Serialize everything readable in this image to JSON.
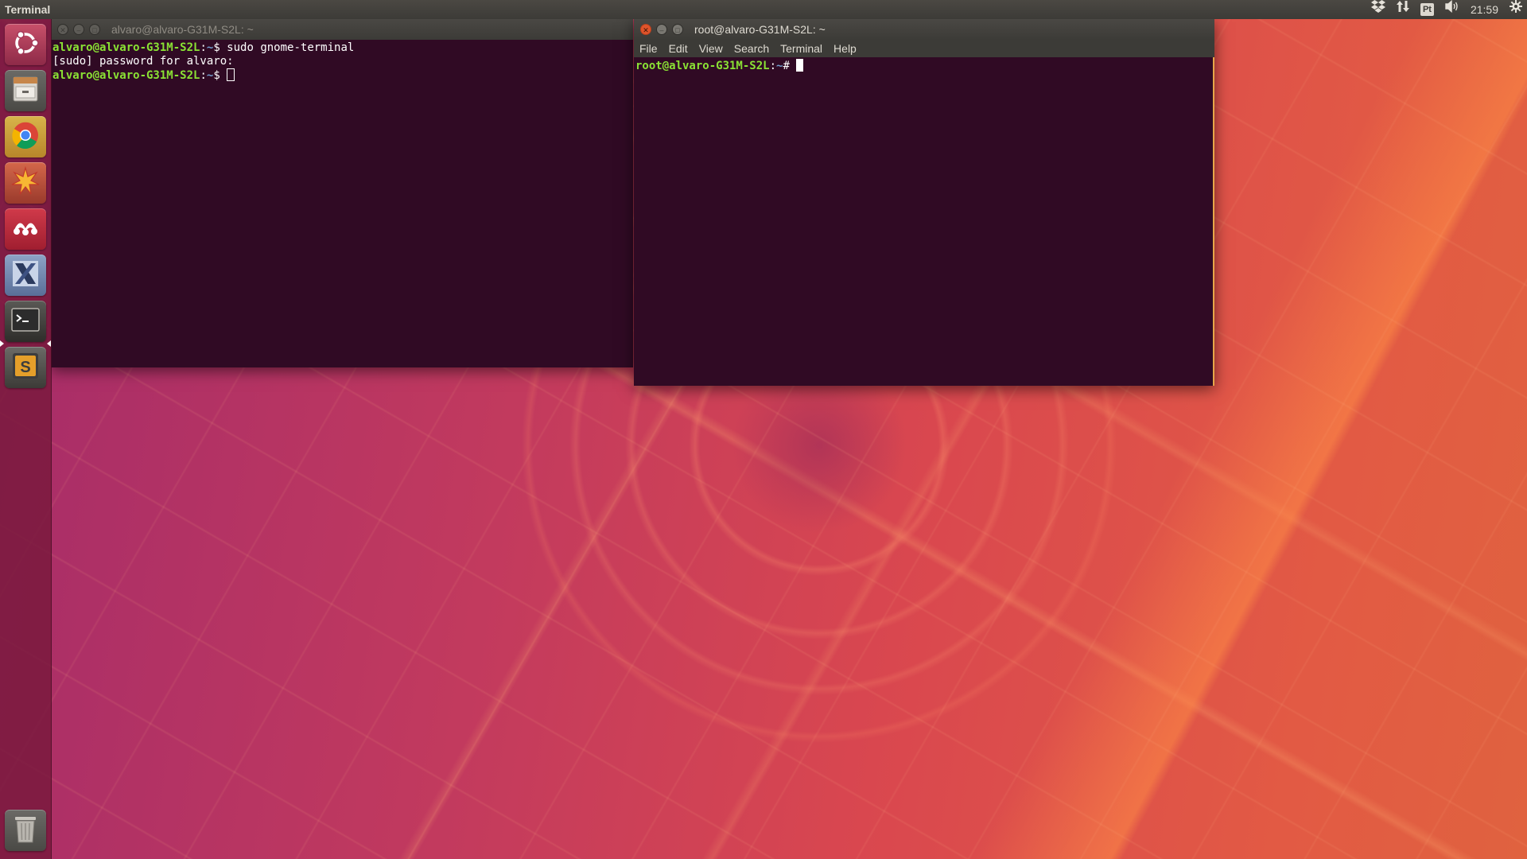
{
  "top_panel": {
    "app_title": "Terminal",
    "keyboard_layout": "Pt",
    "clock": "21:59",
    "icons": [
      "dropbox-icon",
      "network-icon",
      "keyboard-icon",
      "volume-icon",
      "gear-icon"
    ]
  },
  "launcher": {
    "items": [
      {
        "name": "dash-home",
        "icon": "ubuntu-logo-icon"
      },
      {
        "name": "files",
        "icon": "file-cabinet-icon"
      },
      {
        "name": "chrome",
        "icon": "chrome-icon"
      },
      {
        "name": "mathematica",
        "icon": "star-burst-icon"
      },
      {
        "name": "mendeley",
        "icon": "mendeley-icon"
      },
      {
        "name": "x-app",
        "icon": "x-icon"
      },
      {
        "name": "terminal",
        "icon": "terminal-icon"
      },
      {
        "name": "sublime-text",
        "icon": "sublime-icon"
      },
      {
        "name": "trash",
        "icon": "trash-icon"
      }
    ]
  },
  "window_left": {
    "title": "alvaro@alvaro-G31M-S2L: ~",
    "lines": [
      {
        "user": "alvaro@alvaro-G31M-S2L",
        "path": "~",
        "symbol": "$ ",
        "command": "sudo gnome-terminal"
      },
      {
        "text": "[sudo] password for alvaro: "
      },
      {
        "user": "alvaro@alvaro-G31M-S2L",
        "path": "~",
        "symbol": "$ ",
        "command": ""
      }
    ]
  },
  "window_right": {
    "title": "root@alvaro-G31M-S2L: ~",
    "menu": [
      "File",
      "Edit",
      "View",
      "Search",
      "Terminal",
      "Help"
    ],
    "lines": [
      {
        "user": "root@alvaro-G31M-S2L",
        "path": "~",
        "symbol": "# ",
        "command": ""
      }
    ]
  },
  "colors": {
    "terminal_bg": "#300a24",
    "prompt_user": "#8ae234",
    "prompt_path": "#729fcf",
    "panel_bg": "#3c3b37",
    "close_button": "#e0542b"
  }
}
